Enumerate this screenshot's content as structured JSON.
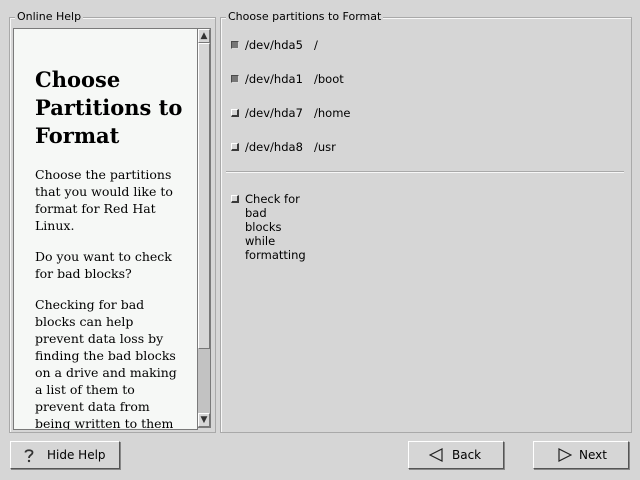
{
  "help": {
    "frame_title": "Online Help",
    "heading": "Choose Partitions to Format",
    "paragraphs": [
      "Choose the partitions that you would like to format for Red Hat Linux.",
      "Do you want to check for bad blocks?",
      "Checking for bad blocks can help prevent data loss by finding the bad blocks on a drive and making a list of them to prevent data from being written to them in the future."
    ]
  },
  "partitions": {
    "frame_title": "Choose partitions to Format",
    "items": [
      {
        "device": "/dev/hda5",
        "mount": "/",
        "checked": true
      },
      {
        "device": "/dev/hda1",
        "mount": "/boot",
        "checked": true
      },
      {
        "device": "/dev/hda7",
        "mount": "/home",
        "checked": false
      },
      {
        "device": "/dev/hda8",
        "mount": "/usr",
        "checked": false
      }
    ],
    "badblocks": {
      "label": "Check for bad blocks while formatting",
      "checked": false
    }
  },
  "buttons": {
    "hide_help": "Hide Help",
    "back": "Back",
    "next": "Next"
  },
  "icons": {
    "help": "question-mark-icon",
    "back": "left-arrow-icon",
    "next": "right-arrow-icon"
  }
}
